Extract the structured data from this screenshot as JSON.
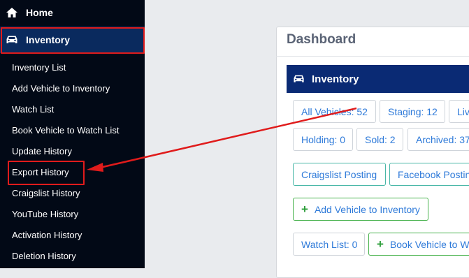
{
  "sidebar": {
    "home_label": "Home",
    "inventory_label": "Inventory",
    "sub_items": [
      "Inventory List",
      "Add Vehicle to Inventory",
      "Watch List",
      "Book Vehicle to Watch List",
      "Update History",
      "Export History",
      "Craigslist History",
      "YouTube History",
      "Activation History",
      "Deletion History"
    ]
  },
  "dashboard": {
    "title": "Dashboard",
    "inventory_header": "Inventory",
    "stats_row1": [
      "All Vehicles: 52",
      "Staging: 12",
      "Liv"
    ],
    "stats_row2": [
      "Holding: 0",
      "Sold: 2",
      "Archived: 37"
    ],
    "posting": [
      "Craigslist Posting",
      "Facebook Postin"
    ],
    "add_vehicle_label": "Add Vehicle to Inventory",
    "watch_list_label": "Watch List: 0",
    "book_vehicle_label": "Book Vehicle to W"
  },
  "colors": {
    "sidebar_bg": "#020916",
    "active_bg": "#0a2a5e",
    "header_bg": "#0a2a74",
    "highlight": "#e01b1b",
    "link": "#2e7ad9"
  },
  "icons": [
    "home-icon",
    "car-icon",
    "plus-icon"
  ]
}
